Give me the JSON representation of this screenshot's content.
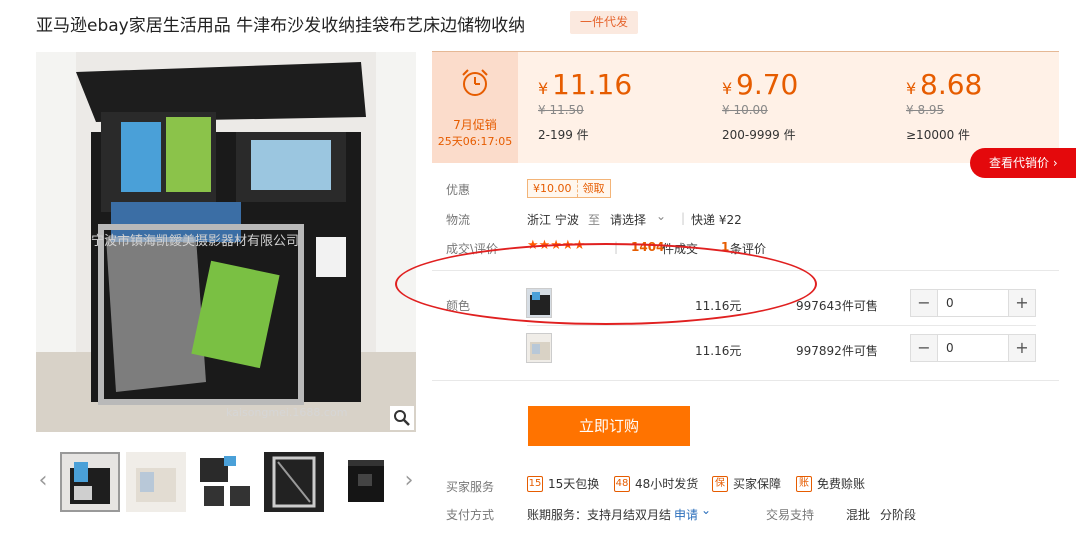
{
  "header": {
    "title": "亚马逊ebay家居生活用品 牛津布沙发收纳挂袋布艺床边储物收纳",
    "badge": "一件代发"
  },
  "gallery": {
    "watermark": "宁波市镇海凯鑀美摄影器材有限公司",
    "watermark_url": "kaisongmei.1688.com",
    "prev_arrow": "‹",
    "next_arrow": "›"
  },
  "promo": {
    "label": "7月促销",
    "countdown": "25天06:17:05"
  },
  "price_tiers": [
    {
      "symbol": "¥",
      "price": "11.16",
      "original": "¥ 11.50",
      "quantity": "2-199 件"
    },
    {
      "symbol": "¥",
      "price": "9.70",
      "original": "¥ 10.00",
      "quantity": "200-9999 件"
    },
    {
      "symbol": "¥",
      "price": "8.68",
      "original": "¥ 8.95",
      "quantity": "≥10000 件"
    }
  ],
  "agent_price_button": "查看代销价 ›",
  "info": {
    "discount_label": "优惠",
    "coupon_value": "¥10.00",
    "coupon_action": "领取",
    "logistics_label": "物流",
    "origin": "浙江 宁波",
    "to": "至",
    "destination": "请选择",
    "shipping": "快递 ¥22",
    "reviews_label": "成交\\评价",
    "stars": "★★★★★",
    "deals_count": "1404",
    "deals_suffix": "件成交",
    "review_count": "1",
    "review_suffix": "条评价"
  },
  "sku": {
    "label": "颜色",
    "rows": [
      {
        "price": "11.16元",
        "stock_num": "997643",
        "stock_suffix": "件可售",
        "qty": "0",
        "minus": "−",
        "plus": "+"
      },
      {
        "price": "11.16元",
        "stock_num": "997892",
        "stock_suffix": "件可售",
        "qty": "0",
        "minus": "−",
        "plus": "+"
      }
    ]
  },
  "buy_button": "立即订购",
  "services": {
    "buyer_label": "买家服务",
    "items": [
      {
        "icon": "15",
        "text": "15天包换"
      },
      {
        "icon": "48",
        "text": "48小时发货"
      },
      {
        "icon": "保",
        "text": "买家保障"
      },
      {
        "icon": "账",
        "text": "免费赊账"
      }
    ],
    "payment_label": "支付方式",
    "payment_text": "账期服务：支持月结双月结",
    "apply": "申请",
    "trade_label": "交易支持",
    "trade_items": [
      "混批",
      "分阶段"
    ]
  },
  "colors": {
    "accent": "#ff7300",
    "price": "#e65c00",
    "red": "#e4090c"
  }
}
